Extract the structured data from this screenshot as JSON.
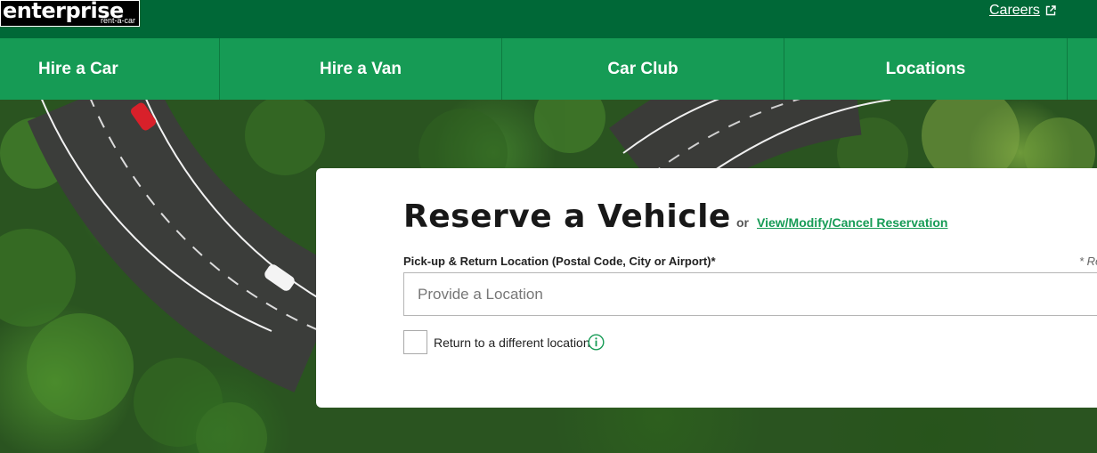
{
  "topbar": {
    "logo_main": "enterprise",
    "logo_sub": "rent-a-car",
    "careers_label": "Careers",
    "external_icon": "external-link-icon"
  },
  "nav": {
    "items": [
      {
        "label": "Hire a Car"
      },
      {
        "label": "Hire a Van"
      },
      {
        "label": "Car Club"
      },
      {
        "label": "Locations"
      }
    ]
  },
  "reserve": {
    "title": "Reserve a Vehicle",
    "or_text": "or",
    "modify_link": "View/Modify/Cancel Reservation",
    "location_label": "Pick-up & Return Location (Postal Code, City or Airport)*",
    "required_note": "* Re",
    "location_placeholder": "Provide a Location",
    "location_value": "",
    "return_label": "Return to a different location",
    "return_checked": false,
    "info_icon": "info-icon"
  },
  "colors": {
    "topbar": "#006837",
    "nav": "#169b55",
    "accent": "#169b55"
  }
}
